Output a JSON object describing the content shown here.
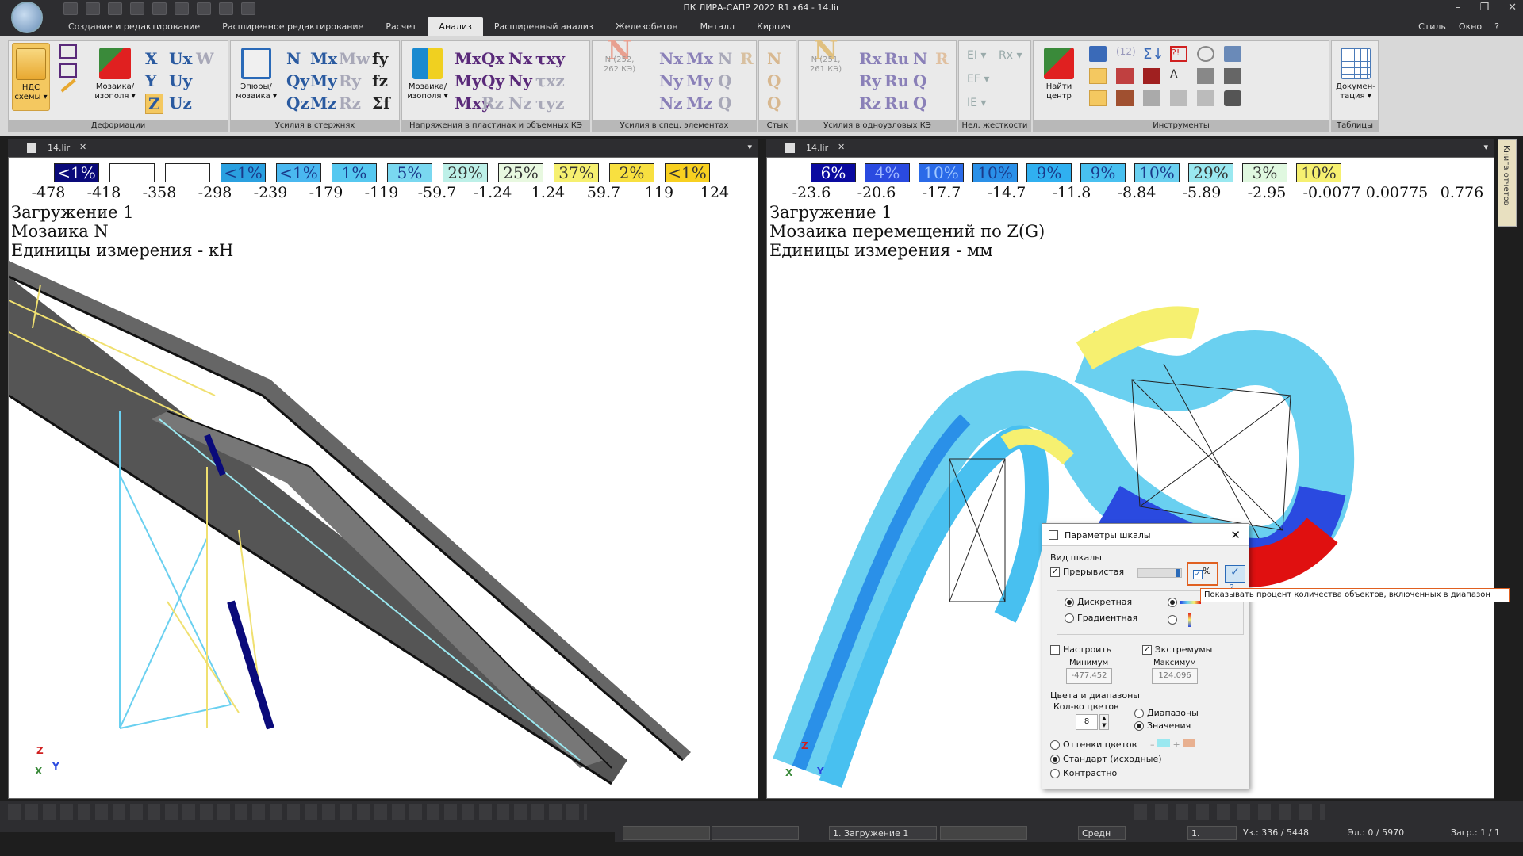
{
  "window": {
    "title": "ПК ЛИРА-САПР  2022 R1 x64 - 14.lir",
    "controls": [
      "–",
      "❐",
      "✕"
    ]
  },
  "menu": {
    "tabs": [
      "Создание и редактирование",
      "Расширенное редактирование",
      "Расчет",
      "Анализ",
      "Расширенный анализ",
      "Железобетон",
      "Металл",
      "Кирпич"
    ],
    "active_tab": "Анализ",
    "right": [
      "Стиль",
      "Окно",
      "?"
    ]
  },
  "ribbon": {
    "groups": {
      "deformations": "Деформации",
      "rod_forces": "Усилия в стержнях",
      "plate_stresses": "Напряжения в пластинах и объемных КЭ",
      "special_forces": "Усилия в спец. элементах",
      "joint": "Стык",
      "single_node": "Усилия в одноузловых КЭ",
      "nonlinear": "Нел. жесткости",
      "tools": "Инструменты",
      "tables": "Таблицы"
    },
    "buttons": {
      "nds_l1": "НДС",
      "nds_l2": "схемы ▾",
      "mosaic_l1": "Мозаика/",
      "mosaic_l2": "изополя ▾",
      "epures_l1": "Эпюры/",
      "epures_l2": "мозаика ▾",
      "plate_mosaic_l1": "Мозаика/",
      "plate_mosaic_l2": "изополя ▾",
      "find_center_l1": "Найти",
      "find_center_l2": "центр",
      "docs_l1": "Докумен-",
      "docs_l2": "тация ▾",
      "n252": "N (252,",
      "n252b": "262 КЭ)",
      "n251": "N (251,",
      "n251b": "261 КЭ)"
    },
    "symbols": {
      "deform": [
        "X",
        "Ux",
        "W",
        "Y",
        "Uy",
        "Z",
        "Uz"
      ],
      "rod": [
        "N",
        "Mx",
        "Mw",
        "Qy",
        "My",
        "Ry",
        "Qz",
        "Mz",
        "Rz"
      ],
      "fy": [
        "fy",
        "fz",
        "Σf"
      ],
      "plate": [
        "Mx",
        "Qx",
        "Nx",
        "τxy",
        "My",
        "Qy",
        "Ny",
        "τxz",
        "Mxy",
        "Rz",
        "Nz",
        "τyz"
      ]
    }
  },
  "left_view": {
    "tab_name": "14.lir",
    "legend_cells": [
      {
        "text": "<1%",
        "color": "#0a0a7a",
        "fg": "#ffffff"
      },
      {
        "text": "",
        "color": "#ffffff",
        "fg": "#333333"
      },
      {
        "text": "",
        "color": "#ffffff",
        "fg": "#333333"
      },
      {
        "text": "<1%",
        "color": "#2aa0e0",
        "fg": "#1a3a8a"
      },
      {
        "text": "<1%",
        "color": "#4ab8f0",
        "fg": "#1a3a8a"
      },
      {
        "text": "1%",
        "color": "#56c8f0",
        "fg": "#1a3a8a"
      },
      {
        "text": "5%",
        "color": "#7ad8f0",
        "fg": "#1a3a8a"
      },
      {
        "text": "29%",
        "color": "#bdf0e8",
        "fg": "#333333"
      },
      {
        "text": "25%",
        "color": "#e8f8e0",
        "fg": "#333333"
      },
      {
        "text": "37%",
        "color": "#f6f070",
        "fg": "#333333"
      },
      {
        "text": "2%",
        "color": "#f8e040",
        "fg": "#333333"
      },
      {
        "text": "<1%",
        "color": "#f8d020",
        "fg": "#333333"
      }
    ],
    "values": [
      "-478",
      "-418",
      "-358",
      "-298",
      "-239",
      "-179",
      "-119",
      "-59.7",
      "-1.24",
      "1.24",
      "59.7",
      "119",
      "124"
    ],
    "load": "Загружение 1",
    "mosaic": "Мозаика N",
    "units": "Единицы измерения - кН"
  },
  "right_view": {
    "tab_name": "14.lir",
    "legend_cells": [
      {
        "text": "6%",
        "color": "#0a0aa0",
        "fg": "#ffffff"
      },
      {
        "text": "4%",
        "color": "#2a4ae0",
        "fg": "#a0b8ff"
      },
      {
        "text": "10%",
        "color": "#2a6ae8",
        "fg": "#a0c8ff"
      },
      {
        "text": "10%",
        "color": "#2a90e8",
        "fg": "#1a3a8a"
      },
      {
        "text": "9%",
        "color": "#30b0f0",
        "fg": "#1a3a8a"
      },
      {
        "text": "9%",
        "color": "#48c0f0",
        "fg": "#1a3a8a"
      },
      {
        "text": "10%",
        "color": "#6ad0f0",
        "fg": "#1a3a8a"
      },
      {
        "text": "29%",
        "color": "#9ae8f0",
        "fg": "#333333"
      },
      {
        "text": "3%",
        "color": "#e0f8e0",
        "fg": "#333333"
      },
      {
        "text": "10%",
        "color": "#f6f070",
        "fg": "#333333"
      }
    ],
    "values": [
      "-23.6",
      "-20.6",
      "-17.7",
      "-14.7",
      "-11.8",
      "-8.84",
      "-5.89",
      "-2.95",
      "-0.0077",
      "0.00775",
      "0.776"
    ],
    "load": "Загружение 1",
    "mosaic": "Мозаика перемещений по Z(G)",
    "units": "Единицы измерения - мм"
  },
  "axes": {
    "z": "Z",
    "x": "X",
    "y": "Y"
  },
  "dialog": {
    "title": "Параметры шкалы",
    "section_view": "Вид шкалы",
    "discontinuous": "Прерывистая",
    "percent": "%",
    "discrete": "Дискретная",
    "gradient": "Градиентная",
    "customize": "Настроить",
    "extremes": "Экстремумы",
    "min_label": "Минимум",
    "max_label": "Максимум",
    "min_value": "-477.452",
    "max_value": "124.096",
    "colors_ranges": "Цвета и диапазоны",
    "color_count_label": "Кол-во цветов",
    "color_count": "8",
    "ranges": "Диапазоны",
    "values_opt": "Значения",
    "shades": "Оттенки цветов",
    "standard": "Стандарт (исходные)",
    "contrast": "Контрастно"
  },
  "tooltip": "Показывать процент количества объектов, включенных в диапазон",
  "side_panel": "Книга отчетов",
  "statusbar": {
    "load_select": "1. Загружение 1",
    "mode_select": "Средн",
    "step_select": "1.",
    "nodes": "Уз.: 336 / 5448",
    "elements": "Эл.: 0 / 5970",
    "loads": "Загр.: 1 / 1"
  }
}
